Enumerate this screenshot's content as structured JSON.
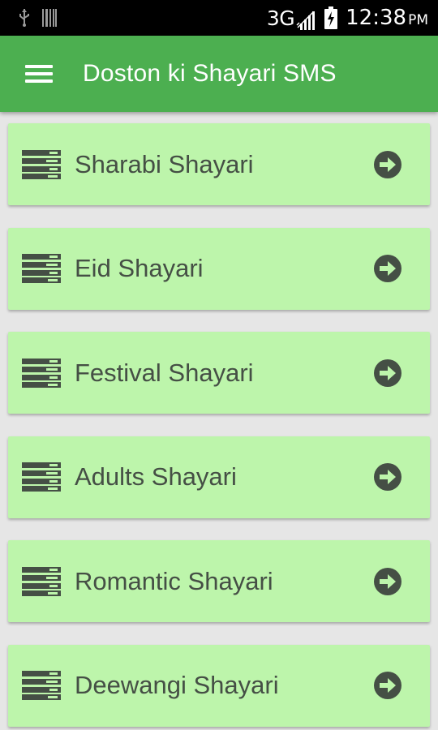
{
  "status_bar": {
    "network": "3G",
    "time": "12:38",
    "meridiem": "PM"
  },
  "app_bar": {
    "title": "Doston ki Shayari SMS",
    "menu_icon": "hamburger-menu-icon"
  },
  "categories": [
    {
      "label": "Sharabi Shayari",
      "icon": "list-lines-icon",
      "action_icon": "arrow-right-circle-icon"
    },
    {
      "label": "Eid Shayari",
      "icon": "list-lines-icon",
      "action_icon": "arrow-right-circle-icon"
    },
    {
      "label": "Festival Shayari",
      "icon": "list-lines-icon",
      "action_icon": "arrow-right-circle-icon"
    },
    {
      "label": "Adults Shayari",
      "icon": "list-lines-icon",
      "action_icon": "arrow-right-circle-icon"
    },
    {
      "label": "Romantic Shayari",
      "icon": "list-lines-icon",
      "action_icon": "arrow-right-circle-icon"
    },
    {
      "label": "Deewangi Shayari",
      "icon": "list-lines-icon",
      "action_icon": "arrow-right-circle-icon"
    }
  ],
  "colors": {
    "app_bar": "#4caf50",
    "card": "#bdf5ab",
    "icon": "#454f45",
    "background": "#e6e6e6"
  }
}
